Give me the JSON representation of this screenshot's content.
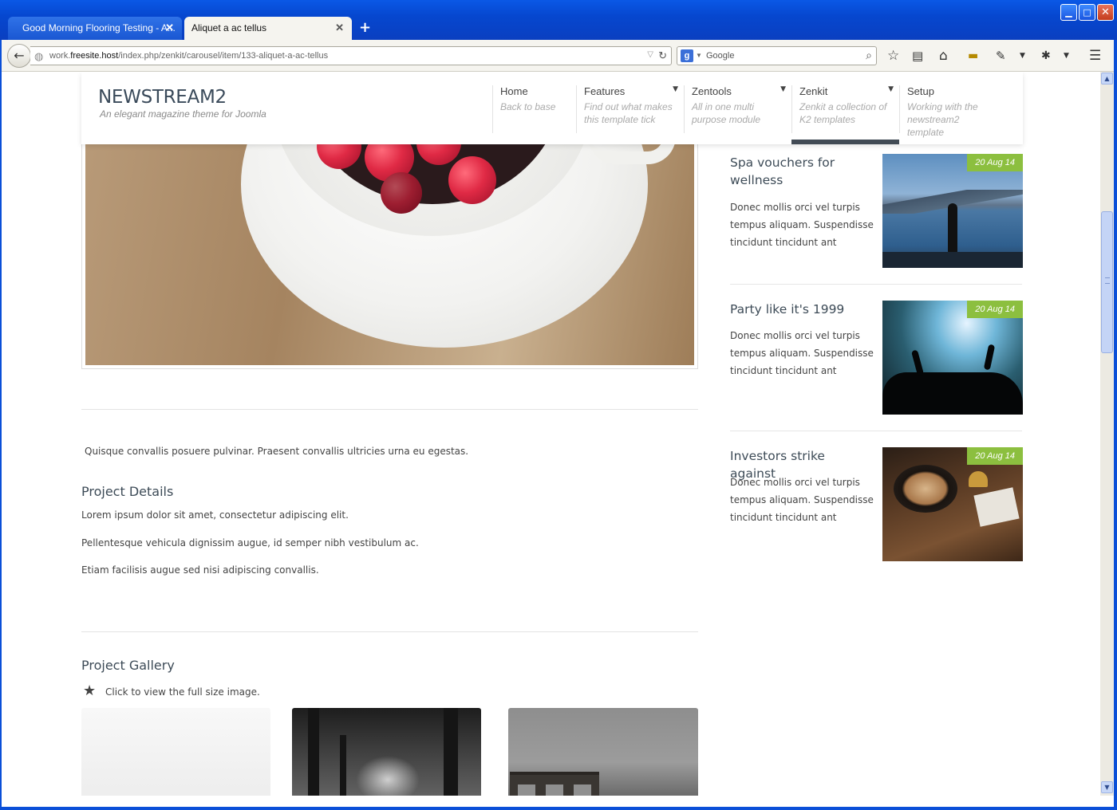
{
  "browser": {
    "tabs": [
      {
        "label": "Good Morning Flooring Testing - A...",
        "active": false
      },
      {
        "label": "Aliquet a ac tellus",
        "active": true
      }
    ],
    "url_prefix": "work.",
    "url_host": "freesite.host",
    "url_path": "/index.php/zenkit/carousel/item/133-aliquet-a-ac-tellus",
    "search_placeholder": "Google"
  },
  "header": {
    "logo": "NEWSTREAM2",
    "tagline": "An elegant magazine theme for Joomla",
    "menu": [
      {
        "title": "Home",
        "sub": "Back to base"
      },
      {
        "title": "Features",
        "sub": "Find out what makes this template tick"
      },
      {
        "title": "Zentools",
        "sub": "All in one multi purpose module"
      },
      {
        "title": "Zenkit",
        "sub": "Zenkit a collection of K2 templates"
      },
      {
        "title": "Setup",
        "sub": "Working with the newstream2 template"
      }
    ]
  },
  "article": {
    "intro": "Quisque convallis posuere pulvinar. Praesent convallis ultricies urna eu egestas.",
    "details_heading": "Project Details",
    "details": [
      "Lorem ipsum dolor sit amet, consectetur adipiscing elit.",
      "Pellentesque vehicula dignissim augue, id semper nibh vestibulum ac.",
      "Etiam facilisis augue sed nisi adipiscing convallis."
    ],
    "gallery_heading": "Project Gallery",
    "gallery_hint": "Click to view the full size image."
  },
  "sidebar": [
    {
      "title": "Spa vouchers for wellness",
      "text": "Donec mollis orci vel turpis tempus aliquam. Suspendisse tincidunt tincidunt ant",
      "date": "20 Aug 14"
    },
    {
      "title": "Party like it's 1999",
      "text": "Donec mollis orci vel turpis tempus aliquam. Suspendisse tincidunt tincidunt ant",
      "date": "20 Aug 14"
    },
    {
      "title": "Investors strike against",
      "text": "Donec mollis orci vel turpis tempus aliquam. Suspendisse tincidunt tincidunt ant",
      "date": "20 Aug 14"
    }
  ],
  "colors": {
    "accent_green": "#8cbf3f",
    "menu_active": "#424b55",
    "heading": "#3d4b57"
  }
}
